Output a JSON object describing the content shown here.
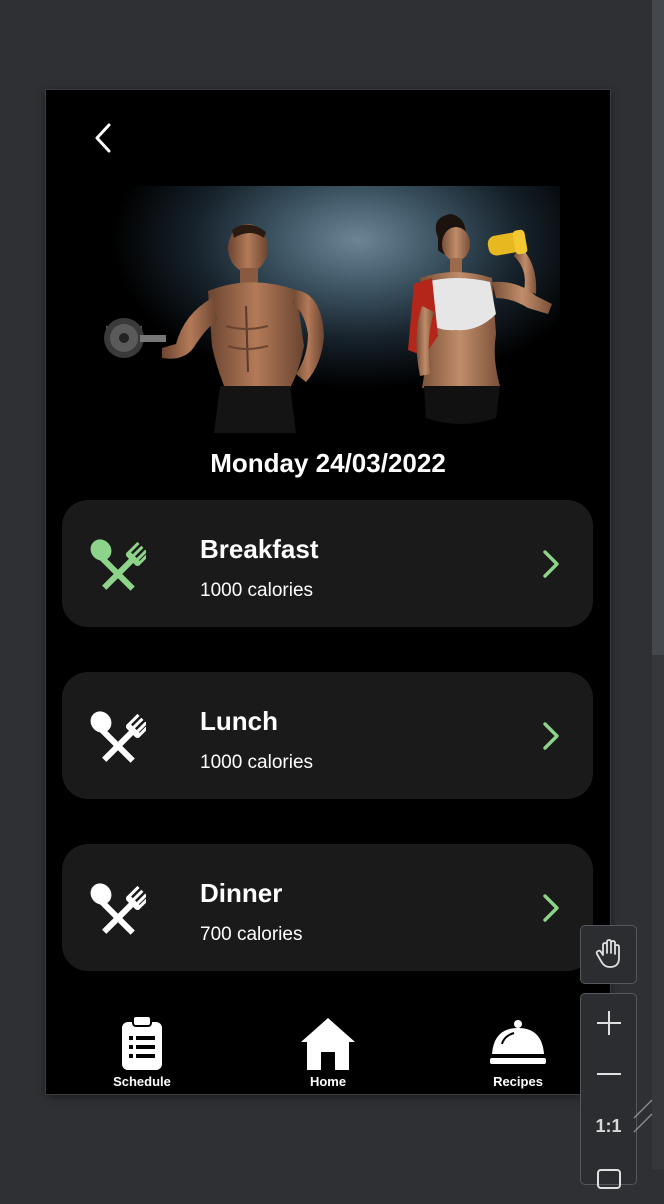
{
  "app": {
    "date_heading": "Monday 24/03/2022",
    "accent_color": "#8dd48a"
  },
  "meals": [
    {
      "name": "Breakfast",
      "calories": "1000 calories",
      "icon": "spoon-fork-icon",
      "active": true
    },
    {
      "name": "Lunch",
      "calories": "1000 calories",
      "icon": "spoon-fork-icon",
      "active": false
    },
    {
      "name": "Dinner",
      "calories": "700 calories",
      "icon": "spoon-fork-icon",
      "active": false
    }
  ],
  "tabbar": {
    "items": [
      {
        "label": "Schedule",
        "icon": "clipboard-icon"
      },
      {
        "label": "Home",
        "icon": "home-icon"
      },
      {
        "label": "Recipes",
        "icon": "cloche-icon"
      }
    ]
  },
  "toolbar": {
    "pan_icon": "hand-icon",
    "zoom_in_icon": "plus-icon",
    "zoom_out_icon": "minus-icon",
    "actual_size_label": "1:1"
  }
}
